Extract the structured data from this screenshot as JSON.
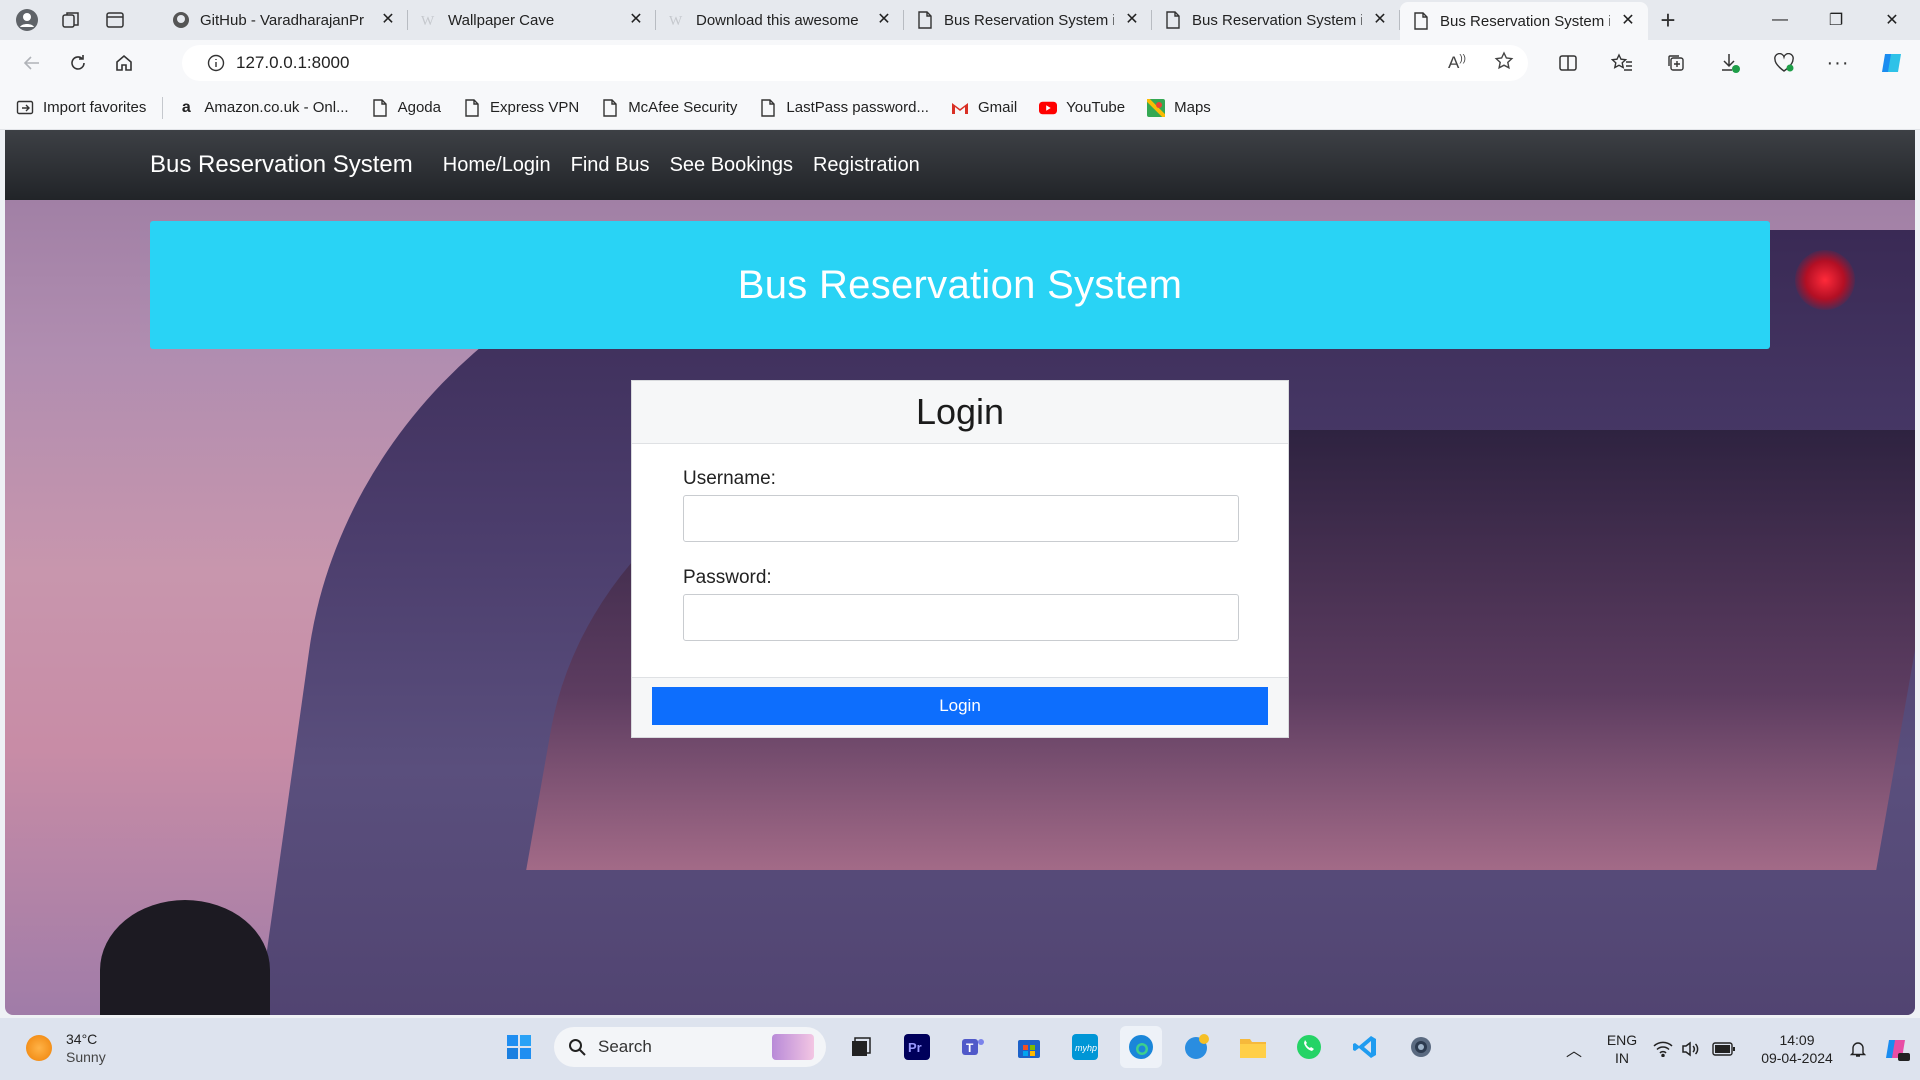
{
  "browser": {
    "tabs": [
      {
        "title": "GitHub - VaradharajanPr",
        "active": false,
        "icon": "github-icon"
      },
      {
        "title": "Wallpaper Cave",
        "active": false,
        "icon": "wallpapercave-icon"
      },
      {
        "title": "Download this awesome",
        "active": false,
        "icon": "wallpapercave-icon"
      },
      {
        "title": "Bus Reservation System in",
        "active": false,
        "icon": "page-icon"
      },
      {
        "title": "Bus Reservation System in",
        "active": false,
        "icon": "page-icon"
      },
      {
        "title": "Bus Reservation System in",
        "active": true,
        "icon": "page-icon"
      }
    ],
    "url": "127.0.0.1:8000",
    "favorites": [
      "Import favorites",
      "Amazon.co.uk - Onl...",
      "Agoda",
      "Express VPN",
      "McAfee Security",
      "LastPass password...",
      "Gmail",
      "YouTube",
      "Maps"
    ]
  },
  "site": {
    "brand": "Bus Reservation System",
    "nav": [
      "Home/Login",
      "Find Bus",
      "See Bookings",
      "Registration"
    ],
    "hero_title": "Bus Reservation System",
    "login": {
      "title": "Login",
      "username_label": "Username:",
      "username_value": "",
      "password_label": "Password:",
      "password_value": "",
      "button_label": "Login"
    }
  },
  "taskbar": {
    "weather_temp": "34°C",
    "weather_desc": "Sunny",
    "search_label": "Search",
    "lang_top": "ENG",
    "lang_bottom": "IN",
    "time": "14:09",
    "date": "09-04-2024"
  },
  "colors": {
    "hero": "#29d3f5",
    "login_button": "#0d6efd",
    "navbar": "#212428"
  }
}
